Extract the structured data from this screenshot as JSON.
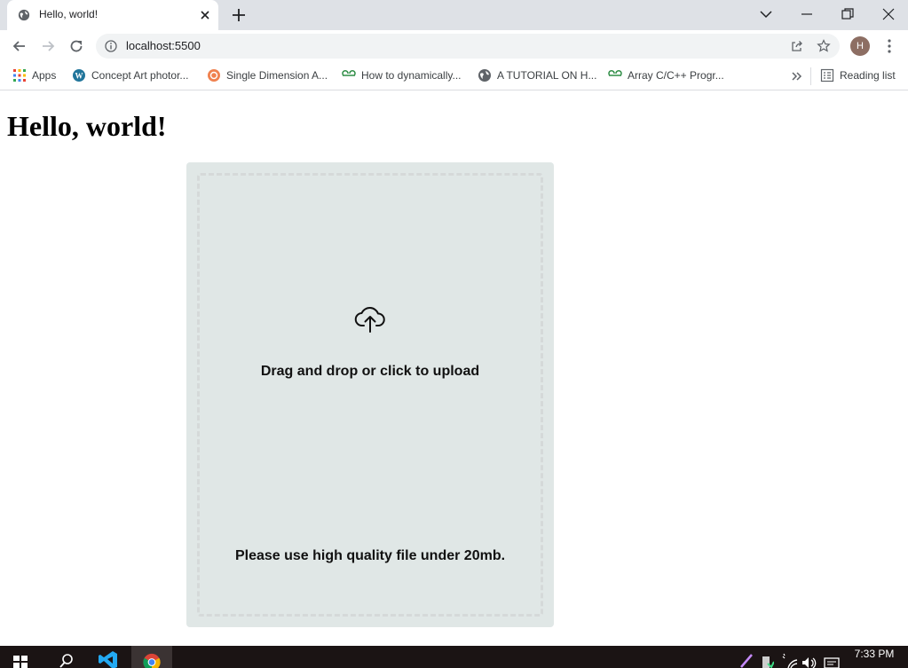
{
  "browser": {
    "tab": {
      "title": "Hello, world!"
    },
    "address": {
      "url": "localhost:5500"
    },
    "profile_initial": "H",
    "bookmarks": [
      {
        "label": "Apps",
        "icon": "apps-grid-icon"
      },
      {
        "label": "Concept Art photor...",
        "icon": "wordpress-icon"
      },
      {
        "label": "Single Dimension A...",
        "icon": "orange-circle-icon"
      },
      {
        "label": "How to dynamically...",
        "icon": "geeksforgeeks-icon"
      },
      {
        "label": "A TUTORIAL ON H...",
        "icon": "globe-icon"
      },
      {
        "label": "Array C/C++ Progr...",
        "icon": "geeksforgeeks-icon"
      }
    ],
    "reading_list": "Reading list"
  },
  "page": {
    "heading": "Hello, world!",
    "dropzone": {
      "primary_text": "Drag and drop or click to upload",
      "secondary_text": "Please use high quality file under 20mb."
    }
  },
  "taskbar": {
    "time": "7:33 PM"
  },
  "colors": {
    "tabstrip": "#dee1e6",
    "omnibox": "#f1f3f4",
    "dropzone_bg": "#e0e7e6",
    "dropzone_border": "#d5d9d9",
    "avatar": "#8d6e63"
  }
}
